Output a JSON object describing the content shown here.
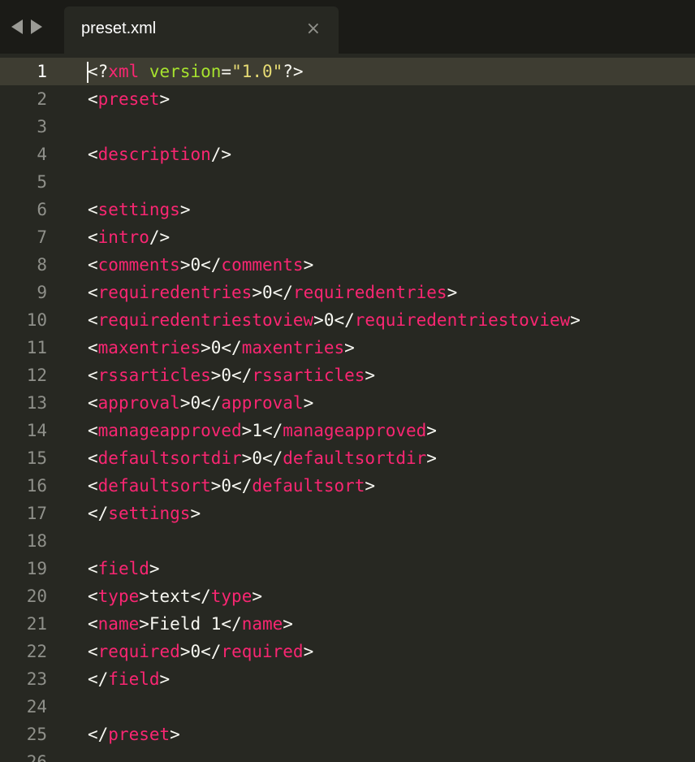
{
  "navigation": {
    "back_icon": "triangle-left-icon",
    "forward_icon": "triangle-right-icon"
  },
  "tab": {
    "title": "preset.xml",
    "close_glyph": "×"
  },
  "editor": {
    "current_line": 1,
    "colors": {
      "background": "#272822",
      "current_line": "#3e3d32",
      "tag": "#f92672",
      "attribute": "#a6e22e",
      "string": "#e6db74",
      "plain": "#f8f8f2",
      "gutter": "#8f908a"
    },
    "lines": [
      {
        "n": "1",
        "tokens": [
          [
            "p",
            "<?"
          ],
          [
            "t",
            "xml"
          ],
          [
            "x",
            " "
          ],
          [
            "a",
            "version"
          ],
          [
            "p",
            "="
          ],
          [
            "s",
            "\"1.0\""
          ],
          [
            "p",
            "?>"
          ]
        ]
      },
      {
        "n": "2",
        "tokens": [
          [
            "p",
            "<"
          ],
          [
            "t",
            "preset"
          ],
          [
            "p",
            ">"
          ]
        ]
      },
      {
        "n": "3",
        "tokens": []
      },
      {
        "n": "4",
        "tokens": [
          [
            "p",
            "<"
          ],
          [
            "t",
            "description"
          ],
          [
            "p",
            "/>"
          ]
        ]
      },
      {
        "n": "5",
        "tokens": []
      },
      {
        "n": "6",
        "tokens": [
          [
            "p",
            "<"
          ],
          [
            "t",
            "settings"
          ],
          [
            "p",
            ">"
          ]
        ]
      },
      {
        "n": "7",
        "tokens": [
          [
            "p",
            "<"
          ],
          [
            "t",
            "intro"
          ],
          [
            "p",
            "/>"
          ]
        ]
      },
      {
        "n": "8",
        "tokens": [
          [
            "p",
            "<"
          ],
          [
            "t",
            "comments"
          ],
          [
            "p",
            ">"
          ],
          [
            "x",
            "0"
          ],
          [
            "p",
            "</"
          ],
          [
            "t",
            "comments"
          ],
          [
            "p",
            ">"
          ]
        ]
      },
      {
        "n": "9",
        "tokens": [
          [
            "p",
            "<"
          ],
          [
            "t",
            "requiredentries"
          ],
          [
            "p",
            ">"
          ],
          [
            "x",
            "0"
          ],
          [
            "p",
            "</"
          ],
          [
            "t",
            "requiredentries"
          ],
          [
            "p",
            ">"
          ]
        ]
      },
      {
        "n": "10",
        "tokens": [
          [
            "p",
            "<"
          ],
          [
            "t",
            "requiredentriestoview"
          ],
          [
            "p",
            ">"
          ],
          [
            "x",
            "0"
          ],
          [
            "p",
            "</"
          ],
          [
            "t",
            "requiredentriestoview"
          ],
          [
            "p",
            ">"
          ]
        ]
      },
      {
        "n": "11",
        "tokens": [
          [
            "p",
            "<"
          ],
          [
            "t",
            "maxentries"
          ],
          [
            "p",
            ">"
          ],
          [
            "x",
            "0"
          ],
          [
            "p",
            "</"
          ],
          [
            "t",
            "maxentries"
          ],
          [
            "p",
            ">"
          ]
        ]
      },
      {
        "n": "12",
        "tokens": [
          [
            "p",
            "<"
          ],
          [
            "t",
            "rssarticles"
          ],
          [
            "p",
            ">"
          ],
          [
            "x",
            "0"
          ],
          [
            "p",
            "</"
          ],
          [
            "t",
            "rssarticles"
          ],
          [
            "p",
            ">"
          ]
        ]
      },
      {
        "n": "13",
        "tokens": [
          [
            "p",
            "<"
          ],
          [
            "t",
            "approval"
          ],
          [
            "p",
            ">"
          ],
          [
            "x",
            "0"
          ],
          [
            "p",
            "</"
          ],
          [
            "t",
            "approval"
          ],
          [
            "p",
            ">"
          ]
        ]
      },
      {
        "n": "14",
        "tokens": [
          [
            "p",
            "<"
          ],
          [
            "t",
            "manageapproved"
          ],
          [
            "p",
            ">"
          ],
          [
            "x",
            "1"
          ],
          [
            "p",
            "</"
          ],
          [
            "t",
            "manageapproved"
          ],
          [
            "p",
            ">"
          ]
        ]
      },
      {
        "n": "15",
        "tokens": [
          [
            "p",
            "<"
          ],
          [
            "t",
            "defaultsortdir"
          ],
          [
            "p",
            ">"
          ],
          [
            "x",
            "0"
          ],
          [
            "p",
            "</"
          ],
          [
            "t",
            "defaultsortdir"
          ],
          [
            "p",
            ">"
          ]
        ]
      },
      {
        "n": "16",
        "tokens": [
          [
            "p",
            "<"
          ],
          [
            "t",
            "defaultsort"
          ],
          [
            "p",
            ">"
          ],
          [
            "x",
            "0"
          ],
          [
            "p",
            "</"
          ],
          [
            "t",
            "defaultsort"
          ],
          [
            "p",
            ">"
          ]
        ]
      },
      {
        "n": "17",
        "tokens": [
          [
            "p",
            "</"
          ],
          [
            "t",
            "settings"
          ],
          [
            "p",
            ">"
          ]
        ]
      },
      {
        "n": "18",
        "tokens": []
      },
      {
        "n": "19",
        "tokens": [
          [
            "p",
            "<"
          ],
          [
            "t",
            "field"
          ],
          [
            "p",
            ">"
          ]
        ]
      },
      {
        "n": "20",
        "tokens": [
          [
            "p",
            "<"
          ],
          [
            "t",
            "type"
          ],
          [
            "p",
            ">"
          ],
          [
            "x",
            "text"
          ],
          [
            "p",
            "</"
          ],
          [
            "t",
            "type"
          ],
          [
            "p",
            ">"
          ]
        ]
      },
      {
        "n": "21",
        "tokens": [
          [
            "p",
            "<"
          ],
          [
            "t",
            "name"
          ],
          [
            "p",
            ">"
          ],
          [
            "x",
            "Field 1"
          ],
          [
            "p",
            "</"
          ],
          [
            "t",
            "name"
          ],
          [
            "p",
            ">"
          ]
        ]
      },
      {
        "n": "22",
        "tokens": [
          [
            "p",
            "<"
          ],
          [
            "t",
            "required"
          ],
          [
            "p",
            ">"
          ],
          [
            "x",
            "0"
          ],
          [
            "p",
            "</"
          ],
          [
            "t",
            "required"
          ],
          [
            "p",
            ">"
          ]
        ]
      },
      {
        "n": "23",
        "tokens": [
          [
            "p",
            "</"
          ],
          [
            "t",
            "field"
          ],
          [
            "p",
            ">"
          ]
        ]
      },
      {
        "n": "24",
        "tokens": []
      },
      {
        "n": "25",
        "tokens": [
          [
            "p",
            "</"
          ],
          [
            "t",
            "preset"
          ],
          [
            "p",
            ">"
          ]
        ]
      },
      {
        "n": "26",
        "tokens": []
      }
    ]
  }
}
